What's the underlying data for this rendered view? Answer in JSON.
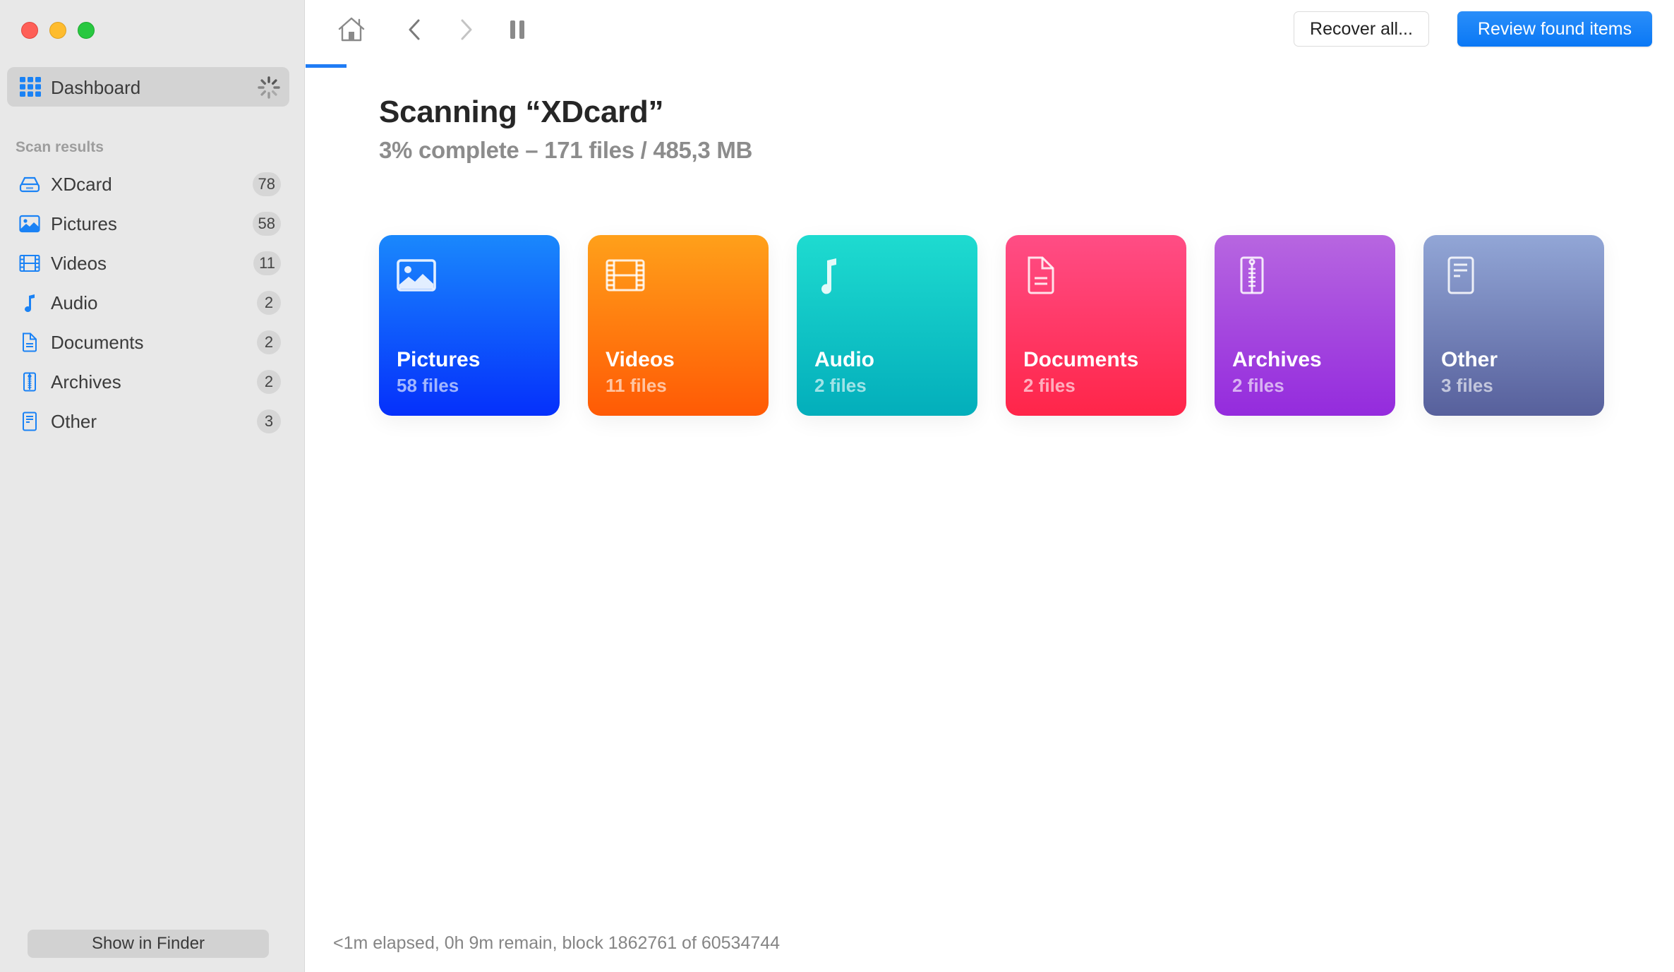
{
  "window": {
    "traffic_lights": [
      "close",
      "minimize",
      "maximize"
    ]
  },
  "sidebar": {
    "dashboard": {
      "label": "Dashboard",
      "icon": "grid-icon",
      "status_icon": "spinner-icon"
    },
    "section_title": "Scan results",
    "items": [
      {
        "label": "XDcard",
        "count": "78",
        "icon": "drive-icon"
      },
      {
        "label": "Pictures",
        "count": "58",
        "icon": "photo-icon"
      },
      {
        "label": "Videos",
        "count": "11",
        "icon": "film-icon"
      },
      {
        "label": "Audio",
        "count": "2",
        "icon": "music-note-icon"
      },
      {
        "label": "Documents",
        "count": "2",
        "icon": "document-icon"
      },
      {
        "label": "Archives",
        "count": "2",
        "icon": "archive-zip-icon"
      },
      {
        "label": "Other",
        "count": "3",
        "icon": "other-file-icon"
      }
    ],
    "show_in_finder_label": "Show in Finder",
    "icon_color": "#1a82f5"
  },
  "toolbar": {
    "home_icon": "home-icon",
    "back_icon": "chevron-left-icon",
    "forward_icon": "chevron-right-icon",
    "pause_icon": "pause-icon",
    "recover_all_label": "Recover all...",
    "review_label": "Review found items",
    "accent_color": "#0a7af5"
  },
  "scan": {
    "title": "Scanning “XDcard”",
    "subtitle": "3% complete – 171 files / 485,3 MB",
    "progress_percent": 3,
    "status_line": "<1m elapsed, 0h 9m remain, block 1862761 of 60534744"
  },
  "categories": [
    {
      "name": "Pictures",
      "files": "58 files",
      "icon": "photo-icon",
      "gradient": [
        "#1a88fc",
        "#0530fb"
      ]
    },
    {
      "name": "Videos",
      "files": "11 files",
      "icon": "film-icon",
      "gradient": [
        "#ffa01a",
        "#ff5a05"
      ]
    },
    {
      "name": "Audio",
      "files": "2 files",
      "icon": "music-note-icon",
      "gradient": [
        "#1edbd0",
        "#03aebb"
      ]
    },
    {
      "name": "Documents",
      "files": "2 files",
      "icon": "document-icon",
      "gradient": [
        "#ff4d85",
        "#ff2549"
      ]
    },
    {
      "name": "Archives",
      "files": "2 files",
      "icon": "archive-zip-icon",
      "gradient": [
        "#b766e0",
        "#942bdd"
      ]
    },
    {
      "name": "Other",
      "files": "3 files",
      "icon": "other-file-icon",
      "gradient": [
        "#92a6d6",
        "#57609c"
      ]
    }
  ]
}
